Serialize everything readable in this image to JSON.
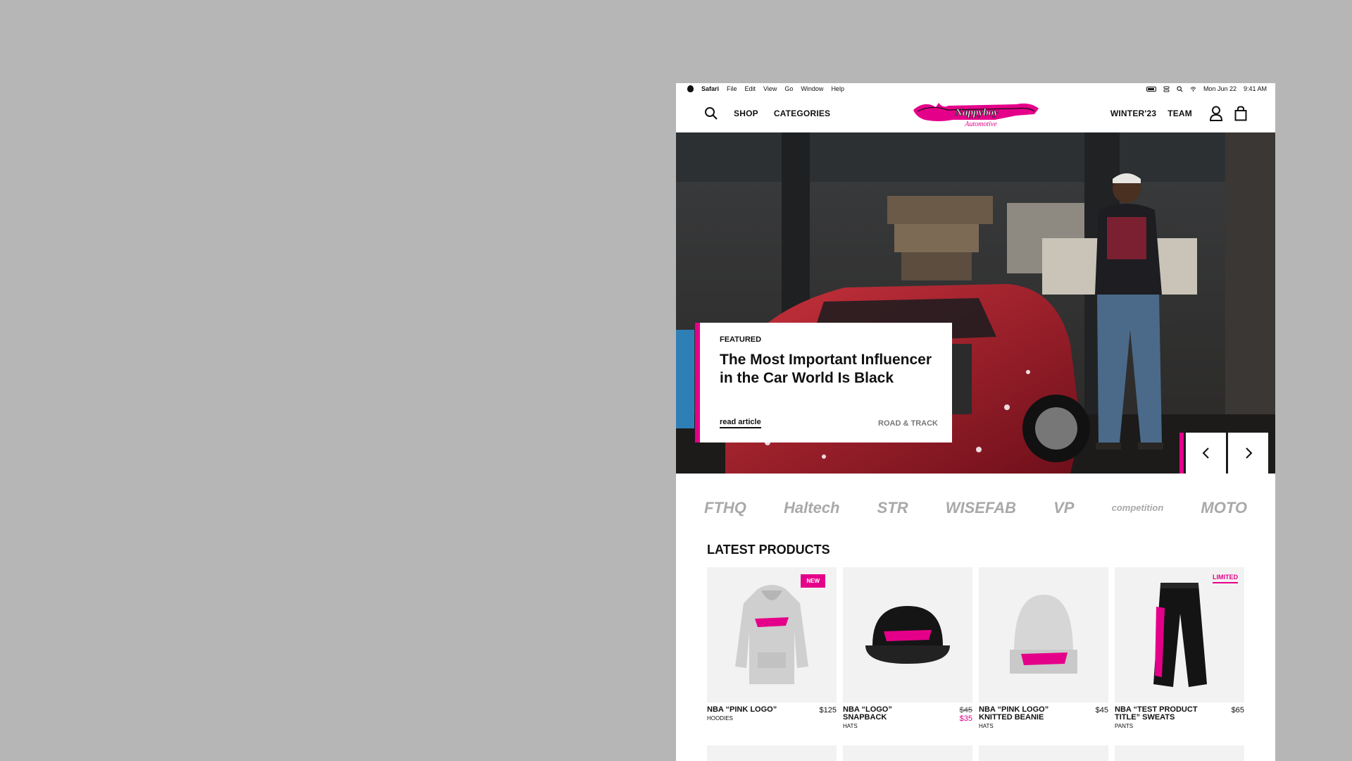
{
  "menubar": {
    "app": "Safari",
    "menus": [
      "File",
      "Edit",
      "View",
      "Go",
      "Window",
      "Help"
    ],
    "date": "Mon Jun 22",
    "time": "9:41 AM"
  },
  "header": {
    "nav_left": [
      "SHOP",
      "CATEGORIES"
    ],
    "nav_right": [
      "WINTER'23",
      "TEAM"
    ],
    "logo_text": "Nappyboy Automotive"
  },
  "hero": {
    "tag": "FEATURED",
    "title": "The Most Important Influencer in the Car World Is Black",
    "read_link": "read article",
    "source": "ROAD & TRACK"
  },
  "brands": [
    "FTHQ",
    "Haltech",
    "STR",
    "WISEFAB",
    "VP",
    "competition",
    "MOTO"
  ],
  "latest": {
    "title": "LATEST PRODUCTS",
    "products": [
      {
        "name": "NBA “PINK LOGO”",
        "category": "HOODIES",
        "price": "$125",
        "badge": "NEW"
      },
      {
        "name": "NBA “LOGO” SNAPBACK",
        "category": "HATS",
        "old_price": "$45",
        "price": "$35"
      },
      {
        "name": "NBA “PINK LOGO” KNITTED BEANIE",
        "category": "HATS",
        "price": "$45"
      },
      {
        "name": "NBA “TEST PRODUCT TITLE” SWEATS",
        "category": "PANTS",
        "price": "$65",
        "badge": "LIMITED"
      }
    ]
  },
  "colors": {
    "accent": "#e5008a",
    "page_bg": "#b6b6b6"
  }
}
